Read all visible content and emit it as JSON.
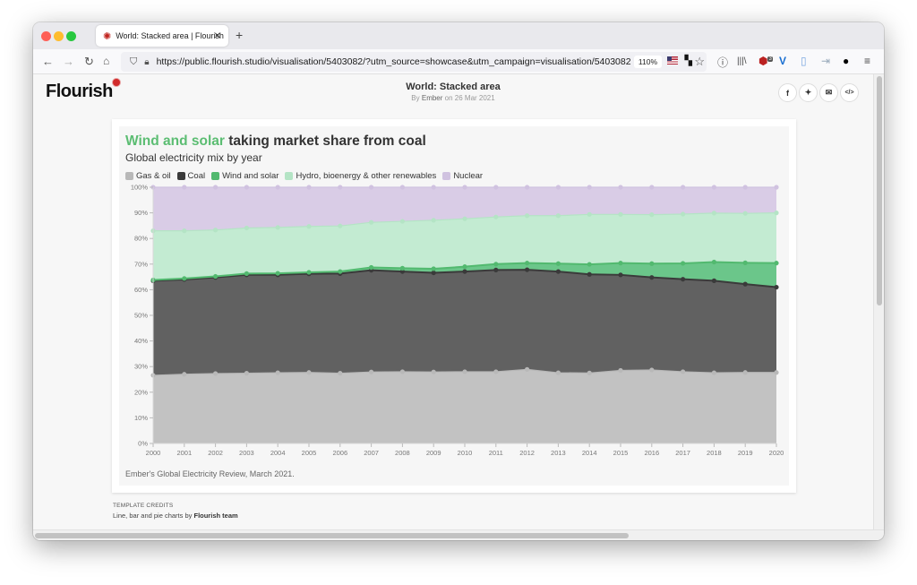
{
  "browser": {
    "tab_title": "World: Stacked area | Flourish",
    "tab_favicon": "flourish-favicon-icon",
    "new_tab": "+",
    "url": "https://public.flourish.studio/visualisation/5403082/?utm_source=showcase&utm_campaign=visualisation/5403082",
    "zoom_level": "110%",
    "extension_badge": "3"
  },
  "page": {
    "logo_text": "Flourish",
    "viz_title": "World: Stacked area",
    "byline_prefix": "By",
    "byline_author": "Ember",
    "byline_date": "on 26 Mar 2021",
    "share_buttons": [
      "facebook",
      "twitter",
      "email",
      "embed"
    ],
    "share_labels": {
      "facebook": "f",
      "twitter": "🐦",
      "email": "✉",
      "embed": "</>"
    },
    "credits_title": "TEMPLATE CREDITS",
    "credits_prefix": "Line, bar and pie charts by",
    "credits_team": "Flourish team"
  },
  "chart_data": {
    "type": "area",
    "stacked": true,
    "title_highlight": "Wind and solar",
    "title_rest": " taking market share from coal",
    "title": "Wind and solar taking market share from coal",
    "subtitle": "Global electricity mix by year",
    "source": "Ember's Global Electricity Review, March 2021.",
    "xlabel": "",
    "ylabel": "",
    "ylim": [
      0,
      100
    ],
    "y_ticks": [
      "0%",
      "10%",
      "20%",
      "30%",
      "40%",
      "50%",
      "60%",
      "70%",
      "80%",
      "90%",
      "100%"
    ],
    "x": [
      2000,
      2001,
      2002,
      2003,
      2004,
      2005,
      2006,
      2007,
      2008,
      2009,
      2010,
      2011,
      2012,
      2013,
      2014,
      2015,
      2016,
      2017,
      2018,
      2019,
      2020
    ],
    "legend_position": "top-left",
    "series": [
      {
        "name": "Gas & oil",
        "color": "#c2c2c2",
        "line": "#b8b8b8",
        "values": [
          26.6,
          27.0,
          27.3,
          27.4,
          27.6,
          27.7,
          27.4,
          27.9,
          28.0,
          27.9,
          28.0,
          28.0,
          28.9,
          27.6,
          27.5,
          28.5,
          28.7,
          28.0,
          27.6,
          27.7,
          27.7
        ]
      },
      {
        "name": "Coal",
        "color": "#616161",
        "line": "#3a3a3a",
        "values": [
          36.9,
          37.0,
          37.5,
          38.4,
          38.2,
          38.5,
          38.9,
          39.7,
          39.1,
          38.7,
          39.1,
          39.7,
          38.9,
          39.5,
          38.5,
          37.3,
          36.1,
          36.1,
          35.9,
          34.5,
          33.3
        ]
      },
      {
        "name": "Wind and solar",
        "color": "#6bc68a",
        "line": "#52b96f",
        "values": [
          0.3,
          0.4,
          0.4,
          0.5,
          0.6,
          0.6,
          0.8,
          1.1,
          1.3,
          1.6,
          1.9,
          2.3,
          2.6,
          3.1,
          3.9,
          4.6,
          5.4,
          6.2,
          7.3,
          8.3,
          9.4
        ]
      },
      {
        "name": "Hydro, bioenergy & other renewables",
        "color": "#c3ebd2",
        "line": "#b4e4c5",
        "values": [
          19.2,
          18.6,
          18.1,
          17.8,
          17.9,
          17.9,
          17.8,
          17.6,
          18.3,
          18.9,
          18.7,
          18.4,
          18.5,
          18.7,
          19.5,
          19.0,
          19.1,
          19.2,
          19.1,
          19.3,
          19.6
        ]
      },
      {
        "name": "Nuclear",
        "color": "#d9cce6",
        "line": "#d0c2e0",
        "values": [
          17.0,
          17.0,
          16.7,
          15.9,
          15.7,
          15.3,
          15.1,
          13.7,
          13.3,
          12.9,
          12.3,
          11.6,
          11.1,
          11.1,
          10.6,
          10.6,
          10.7,
          10.5,
          10.1,
          10.2,
          10.0
        ]
      }
    ]
  }
}
